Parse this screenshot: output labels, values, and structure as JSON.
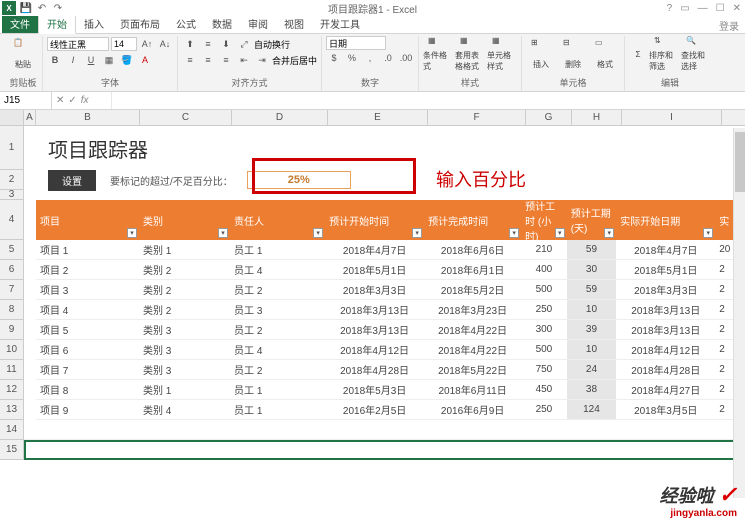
{
  "titlebar": {
    "title": "项目跟踪器1 - Excel"
  },
  "qat": {
    "save": "💾",
    "undo": "↶",
    "redo": "↷"
  },
  "tabs": {
    "file": "文件",
    "home": "开始",
    "insert": "插入",
    "layout": "页面布局",
    "formulas": "公式",
    "data": "数据",
    "review": "审阅",
    "view": "视图",
    "dev": "开发工具"
  },
  "ribbon": {
    "clipboard": {
      "paste": "粘贴",
      "label": "剪贴板"
    },
    "font": {
      "name": "线性正黑",
      "size": "14",
      "label": "字体"
    },
    "align": {
      "wrap": "自动换行",
      "merge": "合并后居中",
      "label": "对齐方式"
    },
    "number": {
      "format": "日期",
      "label": "数字"
    },
    "styles": {
      "cond": "条件格式",
      "table": "套用表格格式",
      "cell": "单元格样式",
      "label": "样式"
    },
    "cells": {
      "insert": "插入",
      "delete": "删除",
      "format": "格式",
      "label": "单元格"
    },
    "editing": {
      "sum": "Σ",
      "sort": "排序和筛选",
      "find": "查找和选择",
      "label": "编辑"
    }
  },
  "formula": {
    "namebox": "J15",
    "fx": "fx"
  },
  "cols": [
    "A",
    "B",
    "C",
    "D",
    "E",
    "F",
    "G",
    "H",
    "I"
  ],
  "rows_upper": [
    "1",
    "2",
    "3"
  ],
  "sheet": {
    "title": "项目跟踪器",
    "setbtn": "设置",
    "mark_label": "要标记的超过/不足百分比：",
    "pct": "25%",
    "hint": "输入百分比"
  },
  "headers": {
    "proj": "项目",
    "cat": "类别",
    "owner": "责任人",
    "est_start": "预计开始时间",
    "est_end": "预计完成时间",
    "est_hours": "预计工时 (小时)",
    "est_days": "预计工期 (天)",
    "act_start": "实际开始日期",
    "act_partial": "实"
  },
  "data": [
    {
      "proj": "项目 1",
      "cat": "类别 1",
      "owner": "员工 1",
      "est_start": "2018年4月7日",
      "est_end": "2018年6月6日",
      "hours": "210",
      "days": "59",
      "act_start": "2018年4月7日",
      "tail": "20"
    },
    {
      "proj": "项目 2",
      "cat": "类别 2",
      "owner": "员工 4",
      "est_start": "2018年5月1日",
      "est_end": "2018年6月1日",
      "hours": "400",
      "days": "30",
      "act_start": "2018年5月1日",
      "tail": "2"
    },
    {
      "proj": "项目 3",
      "cat": "类别 2",
      "owner": "员工 2",
      "est_start": "2018年3月3日",
      "est_end": "2018年5月2日",
      "hours": "500",
      "days": "59",
      "act_start": "2018年3月3日",
      "tail": "2"
    },
    {
      "proj": "项目 4",
      "cat": "类别 2",
      "owner": "员工 3",
      "est_start": "2018年3月13日",
      "est_end": "2018年3月23日",
      "hours": "250",
      "days": "10",
      "act_start": "2018年3月13日",
      "tail": "2"
    },
    {
      "proj": "项目 5",
      "cat": "类别 3",
      "owner": "员工 2",
      "est_start": "2018年3月13日",
      "est_end": "2018年4月22日",
      "hours": "300",
      "days": "39",
      "act_start": "2018年3月13日",
      "tail": "2"
    },
    {
      "proj": "项目 6",
      "cat": "类别 3",
      "owner": "员工 4",
      "est_start": "2018年4月12日",
      "est_end": "2018年4月22日",
      "hours": "500",
      "days": "10",
      "act_start": "2018年4月12日",
      "tail": "2"
    },
    {
      "proj": "项目 7",
      "cat": "类别 3",
      "owner": "员工 2",
      "est_start": "2018年4月28日",
      "est_end": "2018年5月22日",
      "hours": "750",
      "days": "24",
      "act_start": "2018年4月28日",
      "tail": "2"
    },
    {
      "proj": "项目 8",
      "cat": "类别 1",
      "owner": "员工 1",
      "est_start": "2018年5月3日",
      "est_end": "2018年6月11日",
      "hours": "450",
      "days": "38",
      "act_start": "2018年4月27日",
      "tail": "2"
    },
    {
      "proj": "项目 9",
      "cat": "类别 4",
      "owner": "员工 1",
      "est_start": "2016年2月5日",
      "est_end": "2016年6月9日",
      "hours": "250",
      "days": "124",
      "act_start": "2018年3月5日",
      "tail": "2"
    }
  ],
  "data_row_nums": [
    "5",
    "6",
    "7",
    "8",
    "9",
    "10",
    "11",
    "12",
    "13"
  ],
  "extra_row_nums": [
    "14",
    "15"
  ],
  "wm": {
    "main": "经验啦",
    "check": "✓",
    "sub": "jingyanla.com"
  }
}
